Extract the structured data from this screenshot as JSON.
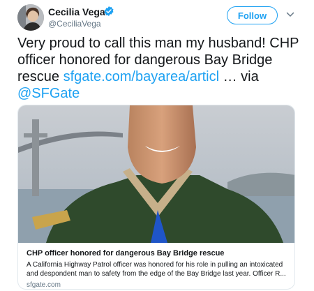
{
  "user": {
    "name": "Cecilia Vega",
    "handle": "@CeciliaVega"
  },
  "actions": {
    "follow_label": "Follow"
  },
  "tweet": {
    "text": "Very proud to call this man my husband! CHP officer honored for dangerous Bay Bridge rescue ",
    "link": "sfgate.com/bayarea/articl",
    "ellipsis": " … via ",
    "mention": "@SFGate"
  },
  "card": {
    "title": "CHP officer honored for dangerous Bay Bridge rescue",
    "description": "A California Highway Patrol officer was honored for his role in pulling an intoxicated and despondent man to safety from the edge of the Bay Bridge last year. Officer R...",
    "domain": "sfgate.com"
  },
  "colors": {
    "accent": "#1da1f2",
    "secondary_text": "#657786",
    "border": "#e1e8ed"
  }
}
